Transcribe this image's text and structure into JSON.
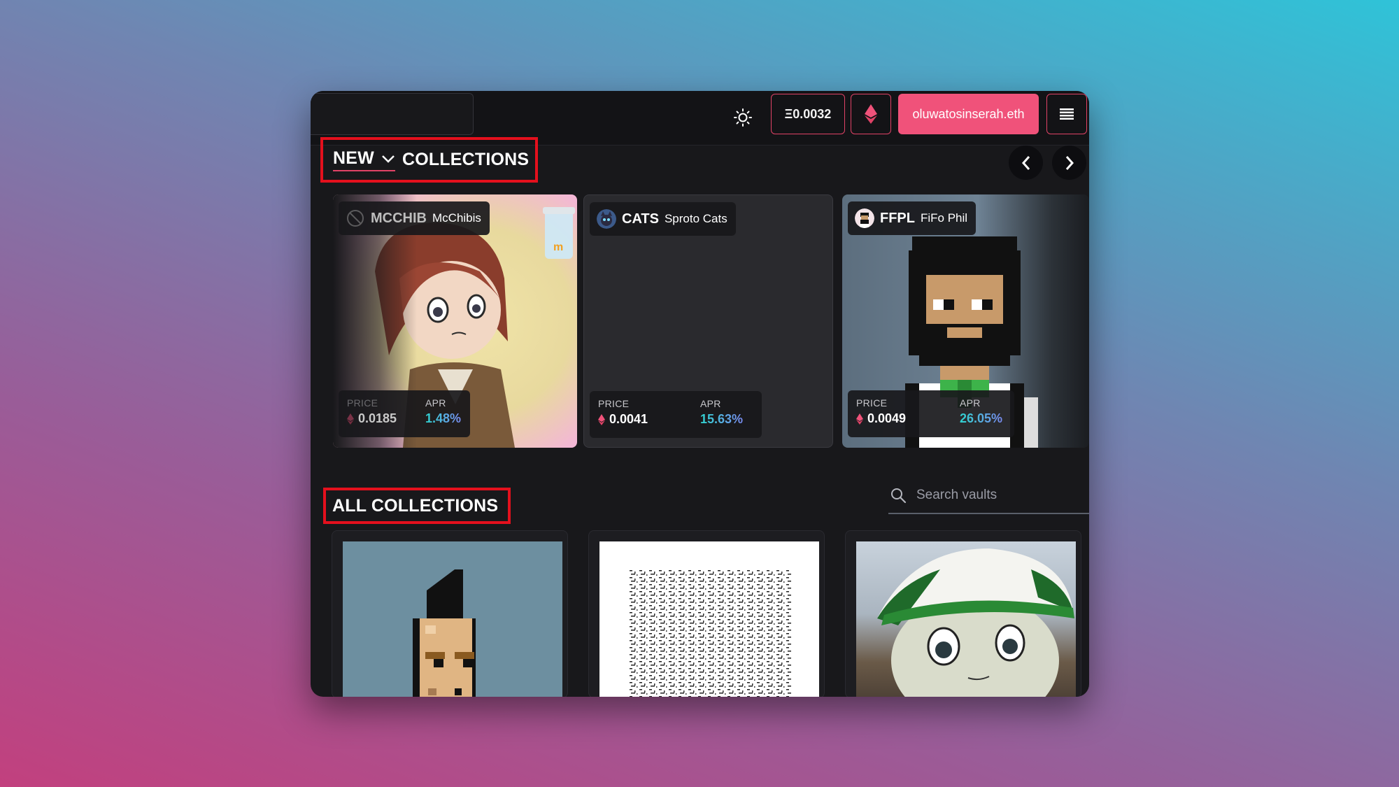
{
  "header": {
    "balance": "Ξ0.0032",
    "account": "oluwatosinserah.eth",
    "icons": {
      "theme": "sun-icon",
      "network": "ethereum-icon",
      "menu": "hamburger-menu-icon"
    }
  },
  "new_section": {
    "filter_label": "NEW",
    "title": "COLLECTIONS",
    "icons": {
      "filter": "chevron-down-icon",
      "prev": "chevron-left-icon",
      "next": "chevron-right-icon"
    }
  },
  "featured": [
    {
      "symbol": "MCCHIB",
      "name": "McChibis",
      "price_label": "PRICE",
      "price": "0.0185",
      "apr_label": "APR",
      "apr": "1.48%"
    },
    {
      "symbol": "CATS",
      "name": "Sproto Cats",
      "price_label": "PRICE",
      "price": "0.0041",
      "apr_label": "APR",
      "apr": "15.63%"
    },
    {
      "symbol": "FFPL",
      "name": "FiFo Phil",
      "price_label": "PRICE",
      "price": "0.0049",
      "apr_label": "APR",
      "apr": "26.05%"
    }
  ],
  "all_section": {
    "title": "ALL COLLECTIONS",
    "search_placeholder": "Search vaults",
    "search_icon": "search-icon"
  },
  "colors": {
    "accent": "#f0527a",
    "border_accent": "#e04266",
    "highlight_box": "#e4101d",
    "background": "#18181b"
  }
}
